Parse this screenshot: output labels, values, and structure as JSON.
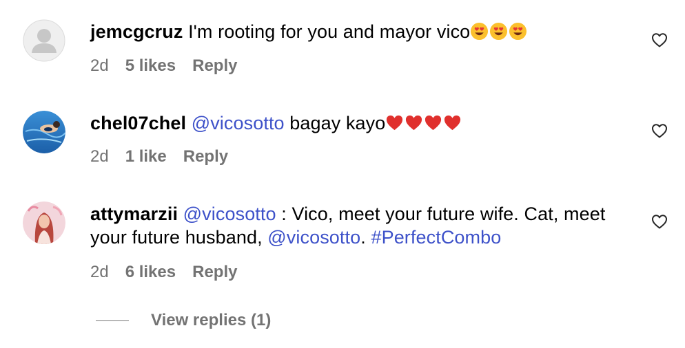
{
  "comments": [
    {
      "username": "jemcgcruz",
      "text": "I'm rooting for you and mayor vico",
      "emoji": [
        "smiling-face-with-heart-eyes",
        "smiling-face-with-heart-eyes",
        "smiling-face-with-heart-eyes"
      ],
      "time": "2d",
      "likes": "5 likes",
      "reply": "Reply"
    },
    {
      "username": "chel07chel",
      "mention": "@vicosotto",
      "text": "bagay kayo",
      "emoji": [
        "red-heart",
        "red-heart",
        "red-heart",
        "red-heart"
      ],
      "time": "2d",
      "likes": "1 like",
      "reply": "Reply"
    },
    {
      "username": "attymarzii",
      "mention_1": "@vicosotto",
      "text_1": ": Vico, meet your future wife. Cat, meet your future husband,",
      "mention_2": "@vicosotto",
      "text_2": ".",
      "hashtag": "#PerfectCombo",
      "time": "2d",
      "likes": "6 likes",
      "reply": "Reply"
    }
  ],
  "view_replies": "View replies (1)",
  "colors": {
    "link": "#3d51c9",
    "secondary_text": "#737373",
    "primary_text": "#000000"
  }
}
